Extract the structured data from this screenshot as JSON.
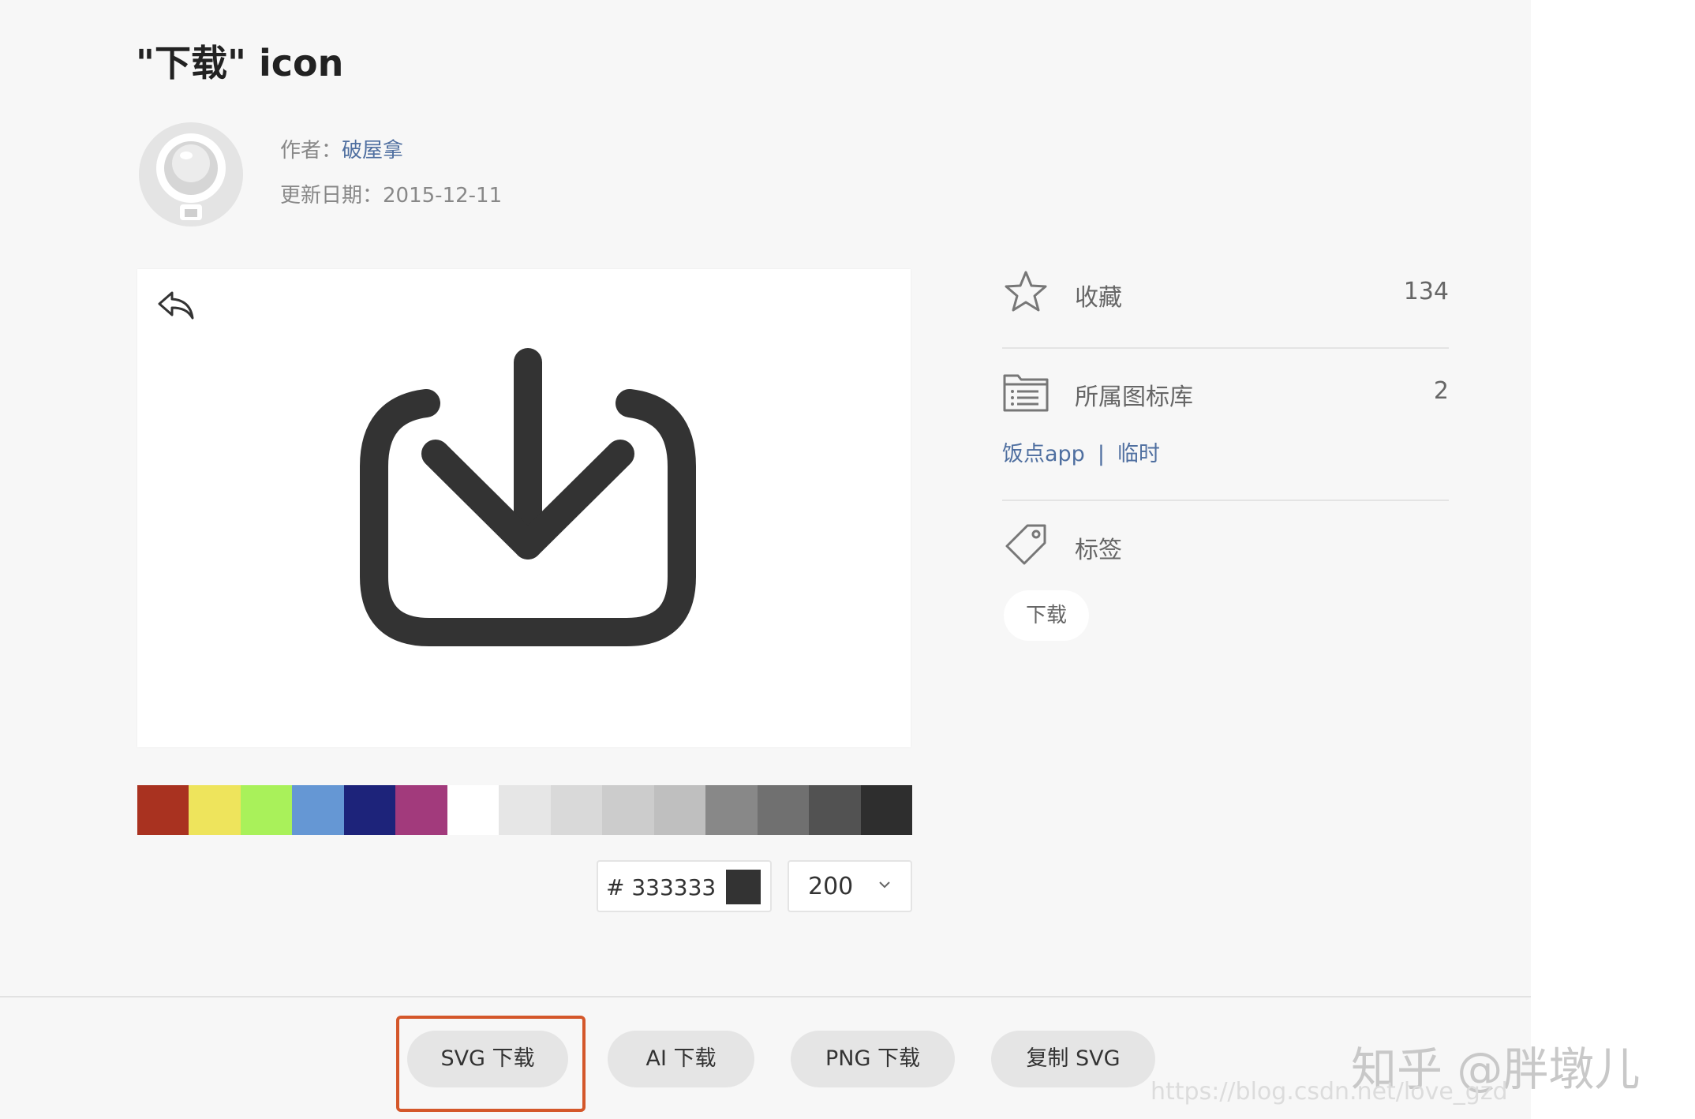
{
  "page": {
    "title": "\"下载\" icon"
  },
  "author": {
    "label": "作者：",
    "name": "破屋拿",
    "date_label": "更新日期：",
    "date": "2015-12-11",
    "avatar_icon": "astronaut-avatar-icon"
  },
  "preview": {
    "back_icon": "undo-icon",
    "main_icon": "download-icon",
    "icon_color": "#333333"
  },
  "palette": {
    "colors": [
      "#a93220",
      "#eee45c",
      "#a9f15a",
      "#6597d4",
      "#1d237a",
      "#a23a7c",
      "#ffffff",
      "#e6e6e6",
      "#d9d9d9",
      "#cccccc",
      "#bfbfbf",
      "#888888",
      "#707070",
      "#525252",
      "#2e2e2e"
    ]
  },
  "controls": {
    "color_value": "# 333333",
    "size_value": "200",
    "size_icon": "chevron-down-icon"
  },
  "sidebar": {
    "collect": {
      "label": "收藏",
      "count": "134",
      "icon": "star-icon"
    },
    "library": {
      "label": "所属图标库",
      "count": "2",
      "icon": "folder-list-icon"
    },
    "library_links": [
      "饭点app",
      "临时"
    ],
    "library_separator": "|",
    "tags": {
      "label": "标签",
      "icon": "tag-icon"
    },
    "tag_items": [
      "下载"
    ]
  },
  "actions": {
    "svg_download": "SVG 下载",
    "ai_download": "AI 下载",
    "png_download": "PNG 下载",
    "copy_svg": "复制 SVG",
    "highlight_color": "#d4572a"
  },
  "watermarks": {
    "zhihu": "知乎 @胖墩儿",
    "url": "https://blog.csdn.net/love_gzd"
  }
}
